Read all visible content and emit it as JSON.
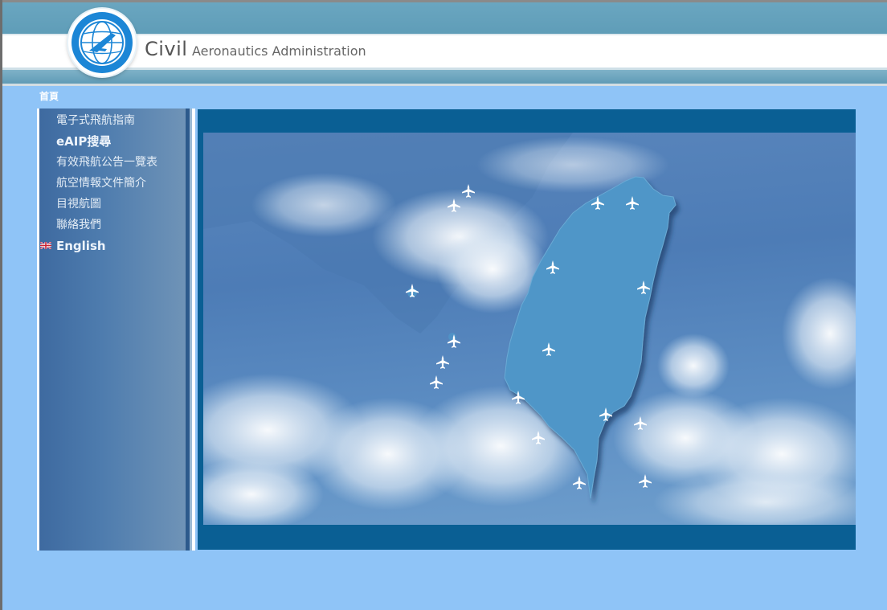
{
  "header": {
    "title_civil": "Civil",
    "title_rest": "Aeronautics Administration",
    "logo_icon": "caa-emblem-icon"
  },
  "breadcrumb": {
    "home": "首頁"
  },
  "sidebar": {
    "items": [
      {
        "label": "電子式飛航指南",
        "bold": false
      },
      {
        "label": "eAIP搜尋",
        "bold": true
      },
      {
        "label": "有效飛航公告一覽表",
        "bold": false
      },
      {
        "label": "航空情報文件簡介",
        "bold": false
      },
      {
        "label": "目視航圖",
        "bold": false
      },
      {
        "label": "聯絡我們",
        "bold": false
      },
      {
        "label": "English",
        "bold": true,
        "icon": "uk-flag-icon"
      }
    ]
  },
  "map": {
    "island": "taiwan-map",
    "airport_icon": "airplane-icon",
    "colors": {
      "panel": "#0a5f94",
      "island": "#4f96c8",
      "page_bg": "#8fc4f7"
    }
  }
}
